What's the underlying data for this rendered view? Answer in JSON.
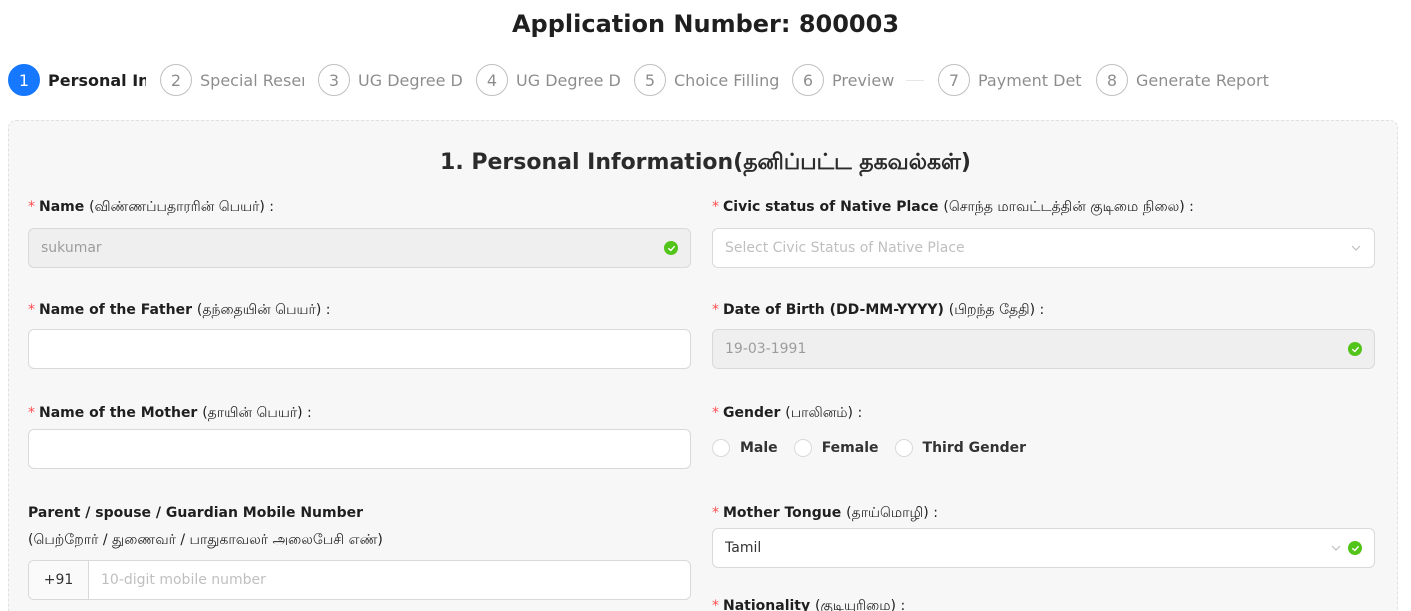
{
  "header": {
    "application_number": "Application Number: 800003"
  },
  "steps": [
    {
      "number": "1",
      "title": "Personal Information",
      "active": true
    },
    {
      "number": "2",
      "title": "Special Reservation",
      "active": false
    },
    {
      "number": "3",
      "title": "UG Degree Details",
      "active": false
    },
    {
      "number": "4",
      "title": "UG Degree Details",
      "active": false
    },
    {
      "number": "5",
      "title": "Choice Filling",
      "active": false
    },
    {
      "number": "6",
      "title": "Preview",
      "active": false
    },
    {
      "number": "7",
      "title": "Payment Details",
      "active": false
    },
    {
      "number": "8",
      "title": "Generate Report",
      "active": false
    }
  ],
  "section": {
    "title": "1. Personal Information(தனிப்பட்ட தகவல்கள்)"
  },
  "form": {
    "name": {
      "label_en": "Name",
      "label_ta": "(விண்ணப்பதாரரின் பெயர்) :",
      "value": "sukumar"
    },
    "civic_status": {
      "label_en": "Civic status of Native Place",
      "label_ta": "(சொந்த மாவட்டத்தின் குடிமை நிலை) :",
      "placeholder": "Select Civic Status of Native Place"
    },
    "father_name": {
      "label_en": "Name of the Father",
      "label_ta": "(தந்தையின் பெயர்) :",
      "value": ""
    },
    "dob": {
      "label_en": "Date of Birth (DD-MM-YYYY)",
      "label_ta": "(பிறந்த தேதி) :",
      "value": "19-03-1991"
    },
    "mother_name": {
      "label_en": "Name of the Mother",
      "label_ta": "(தாயின் பெயர்) :",
      "value": ""
    },
    "gender": {
      "label_en": "Gender",
      "label_ta": "(பாலினம்) :",
      "options": [
        "Male",
        "Female",
        "Third Gender"
      ]
    },
    "guardian_mobile": {
      "label_line1": "Parent / spouse / Guardian Mobile Number",
      "label_line2": "(பெற்றோர் / துணைவர் / பாதுகாவலர் அலைபேசி எண்)",
      "prefix": "+91",
      "placeholder": "10-digit mobile number"
    },
    "mother_tongue": {
      "label_en": "Mother Tongue",
      "label_ta": "(தாய்மொழி) :",
      "value": "Tamil"
    },
    "nationality": {
      "label_en": "Nationality",
      "label_ta": "(குடியுரிமை) :"
    }
  },
  "colors": {
    "primary": "#1677ff",
    "success": "#52c41a",
    "required": "#ff4d4f"
  }
}
